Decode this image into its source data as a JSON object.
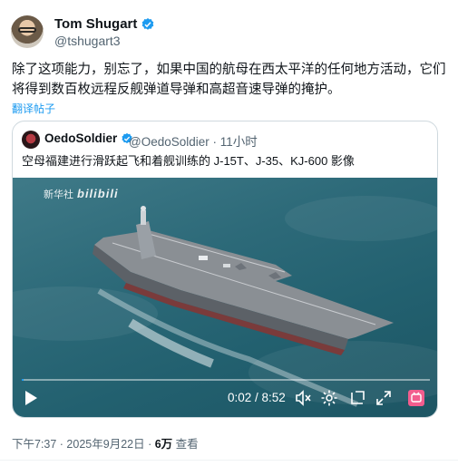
{
  "author": {
    "name": "Tom Shugart",
    "handle": "@tshugart3"
  },
  "tweet": {
    "text": "除了这项能力，别忘了，如果中国的航母在西太平洋的任何地方活动，它们将得到数百枚远程反舰弹道导弹和高超音速导弹的掩护。",
    "translate_label": "翻译帖子"
  },
  "quoted": {
    "name": "OedoSoldier",
    "meta": "@OedoSoldier · 11小时",
    "text": "空母福建进行滑跃起飞和着舰训练的 J-15T、J-35、KJ-600 影像",
    "video": {
      "watermark_text": "新华社",
      "watermark_brand": "bilibili",
      "time": "0:02 / 8:52",
      "progress": 0.004
    }
  },
  "footer": {
    "datetime": "下午7:37 · 2025年9月22日 · ",
    "views_count": "6万",
    "views_label": " 查看"
  },
  "colors": {
    "accent": "#1d9bf0",
    "text": "#0f1419",
    "muted": "#536471",
    "border": "#cfd9de"
  },
  "icons": [
    "verified-icon",
    "play-icon",
    "mute-icon",
    "settings-icon",
    "fullscreen-exit-icon",
    "expand-icon",
    "bilibili-icon"
  ]
}
